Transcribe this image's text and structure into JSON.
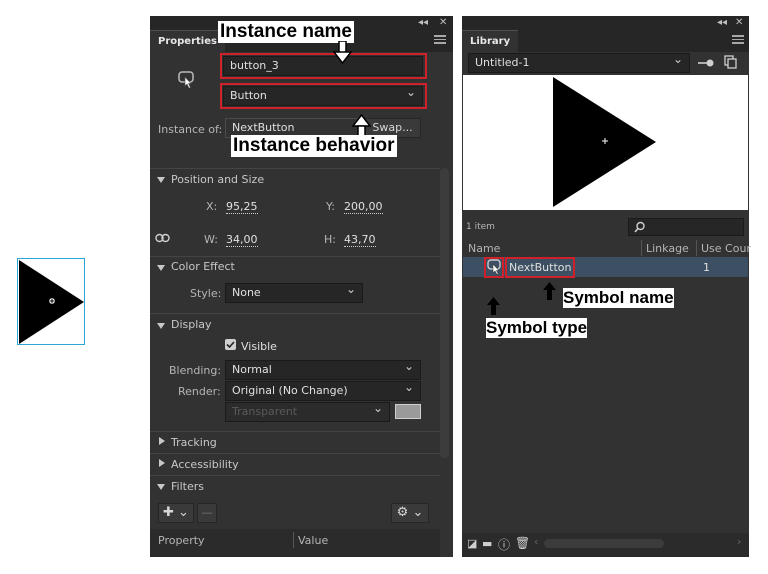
{
  "properties": {
    "tab": "Properties",
    "collapse": "◂◂",
    "close": "✕",
    "instance_name": "button_3",
    "behavior": "Button",
    "instance_of_label": "Instance of:",
    "instance_of_value": "NextButton",
    "swap_label": "Swap...",
    "position_size": {
      "header": "Position and Size",
      "x_label": "X:",
      "x_value": "95,25",
      "y_label": "Y:",
      "y_value": "200,00",
      "w_label": "W:",
      "w_value": "34,00",
      "h_label": "H:",
      "h_value": "43,70"
    },
    "color_effect": {
      "header": "Color Effect",
      "style_label": "Style:",
      "style_value": "None"
    },
    "display": {
      "header": "Display",
      "visible_label": "Visible",
      "blending_label": "Blending:",
      "blending_value": "Normal",
      "render_label": "Render:",
      "render_value": "Original (No Change)",
      "transparent_value": "Transparent"
    },
    "tracking": "Tracking",
    "accessibility": "Accessibility",
    "filters": {
      "header": "Filters",
      "col_property": "Property",
      "col_value": "Value"
    }
  },
  "library": {
    "tab": "Library",
    "collapse": "◂◂",
    "close": "✕",
    "document": "Untitled-1",
    "item_count": "1 item",
    "columns": [
      "Name",
      "Linkage",
      "Use Cour"
    ],
    "items": [
      {
        "name": "NextButton",
        "use_count": "1"
      }
    ]
  },
  "annotations": {
    "instance_name": "Instance name",
    "instance_behavior": "Instance behavior",
    "symbol_name": "Symbol name",
    "symbol_type": "Symbol type"
  },
  "colors": {
    "panel": "#323232",
    "highlight": "#d0202a",
    "selection": "#3d4f62",
    "stage_border": "#2aa7d8"
  }
}
